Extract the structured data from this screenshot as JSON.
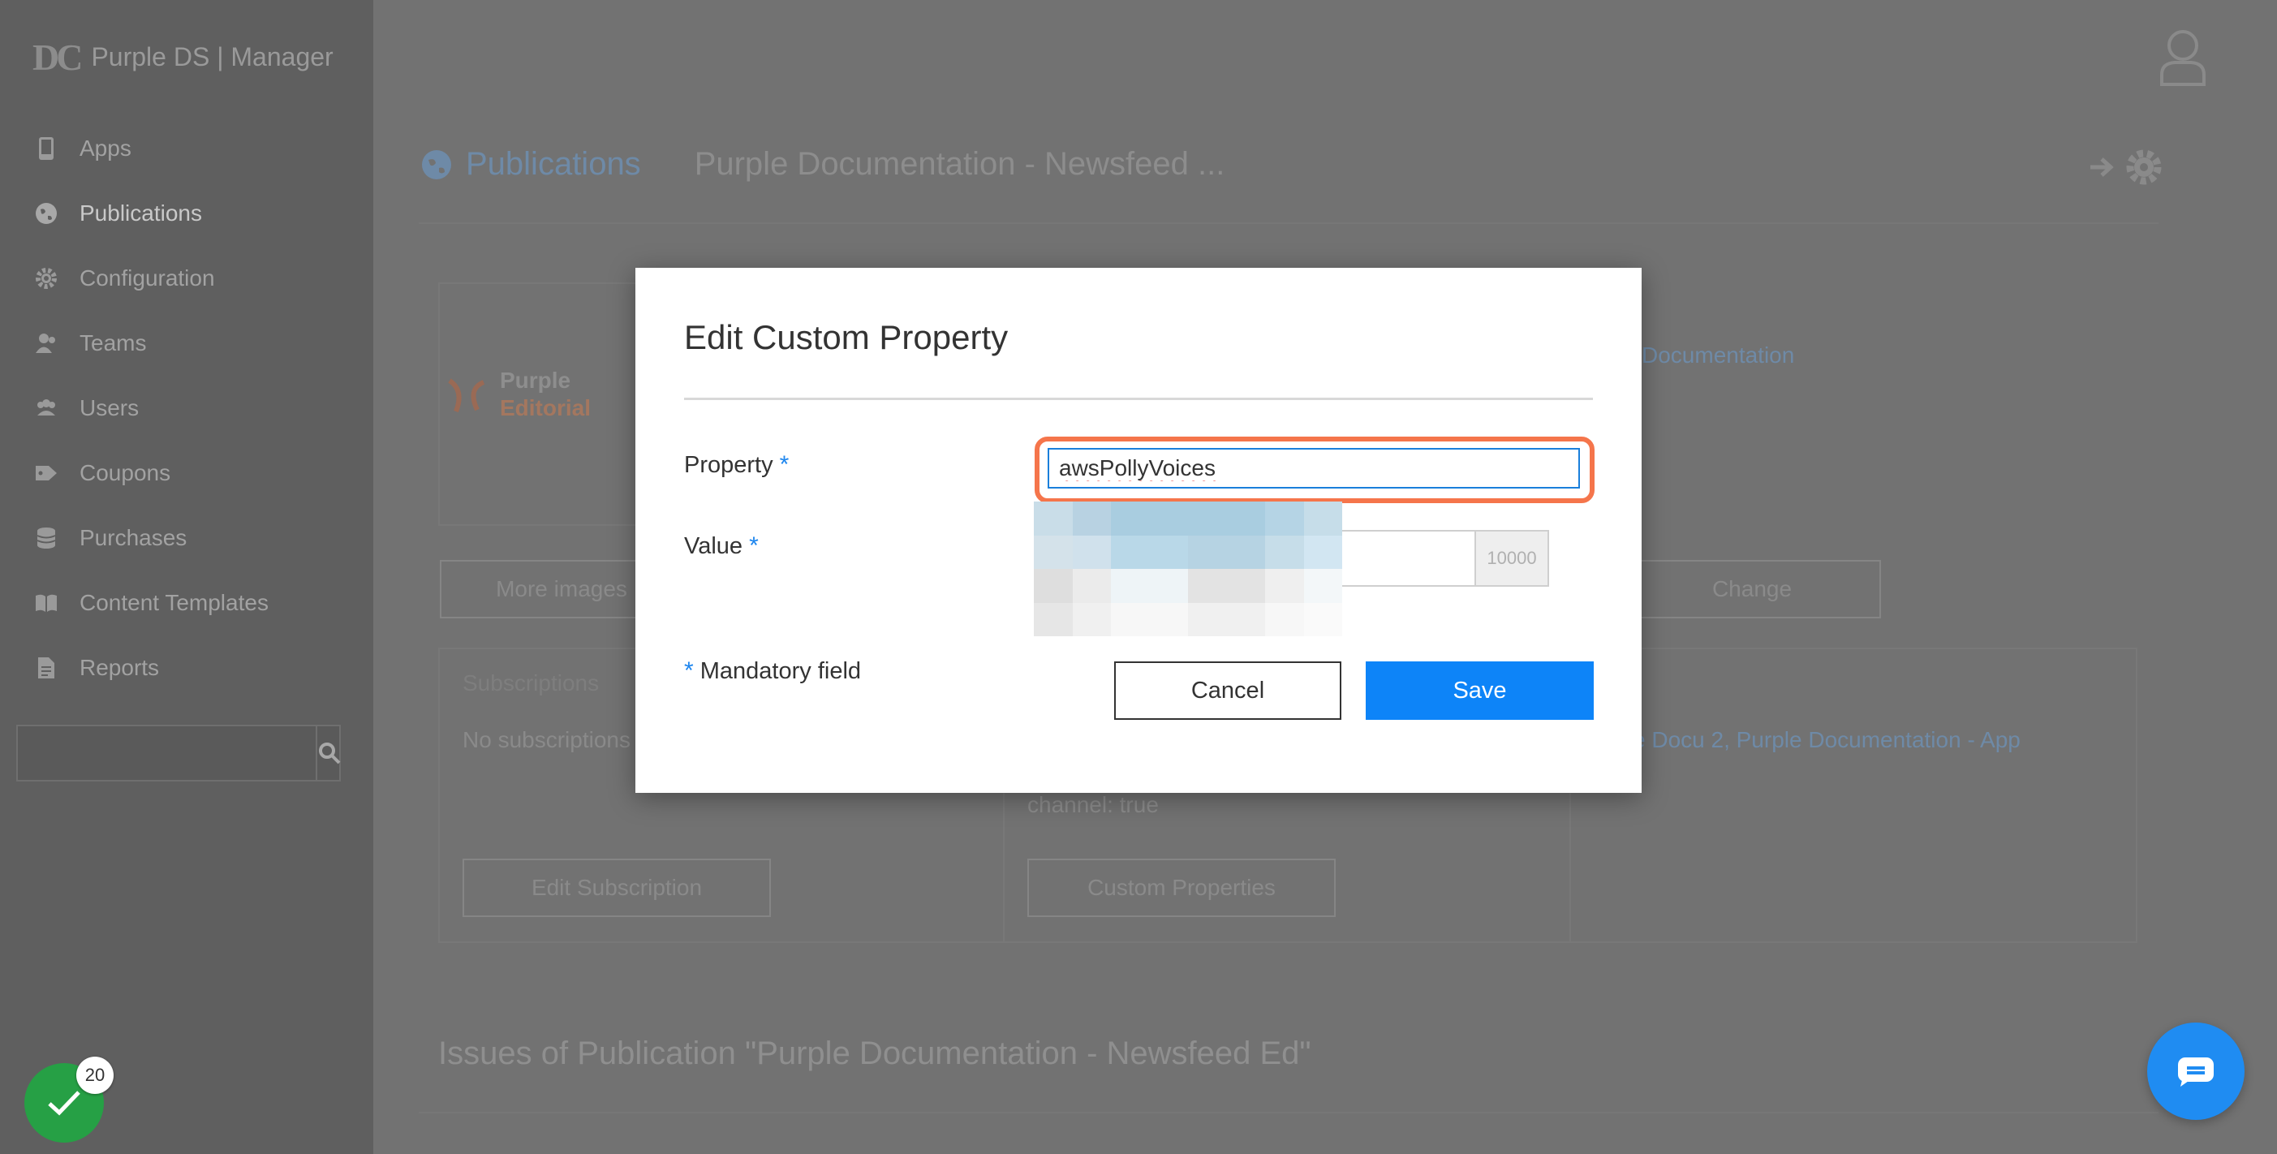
{
  "app": {
    "brand_logo": "DC",
    "brand_name": "Purple DS | Manager"
  },
  "sidebar": {
    "items": [
      {
        "label": "Apps",
        "icon": "phone-icon"
      },
      {
        "label": "Publications",
        "icon": "globe-icon"
      },
      {
        "label": "Configuration",
        "icon": "gear-icon"
      },
      {
        "label": "Teams",
        "icon": "team-icon"
      },
      {
        "label": "Users",
        "icon": "users-icon"
      },
      {
        "label": "Coupons",
        "icon": "tag-icon"
      },
      {
        "label": "Purchases",
        "icon": "database-icon"
      },
      {
        "label": "Content Templates",
        "icon": "book-icon"
      },
      {
        "label": "Reports",
        "icon": "document-icon"
      }
    ],
    "search_placeholder": ""
  },
  "header": {
    "section": "Publications",
    "title": "Purple Documentation - Newsfeed ..."
  },
  "background": {
    "logo_line1": "Purple",
    "logo_line2": "Editorial",
    "doc_link": "Documentation",
    "more_images": "More images",
    "change": "Change",
    "subscriptions_heading": "Subscriptions",
    "no_subscriptions": "No subscriptions",
    "links": "e Docu 2, Purple Documentation - App",
    "channel_text": "channel: true",
    "edit_subscription": "Edit Subscription",
    "custom_properties": "Custom Properties",
    "issues_heading": "Issues of Publication \"Purple Documentation - Newsfeed Ed\""
  },
  "modal": {
    "title": "Edit Custom Property",
    "property_label": "Property",
    "property_value": "awsPollyVoices",
    "value_label": "Value",
    "value_value": "",
    "value_counter": "10000",
    "required_mark": "*",
    "mandatory_text": "Mandatory field",
    "cancel_label": "Cancel",
    "save_label": "Save"
  },
  "notifications": {
    "count": "20"
  },
  "colors": {
    "accent": "#0d84f8",
    "highlight": "#f5754b",
    "success": "#26a045"
  }
}
